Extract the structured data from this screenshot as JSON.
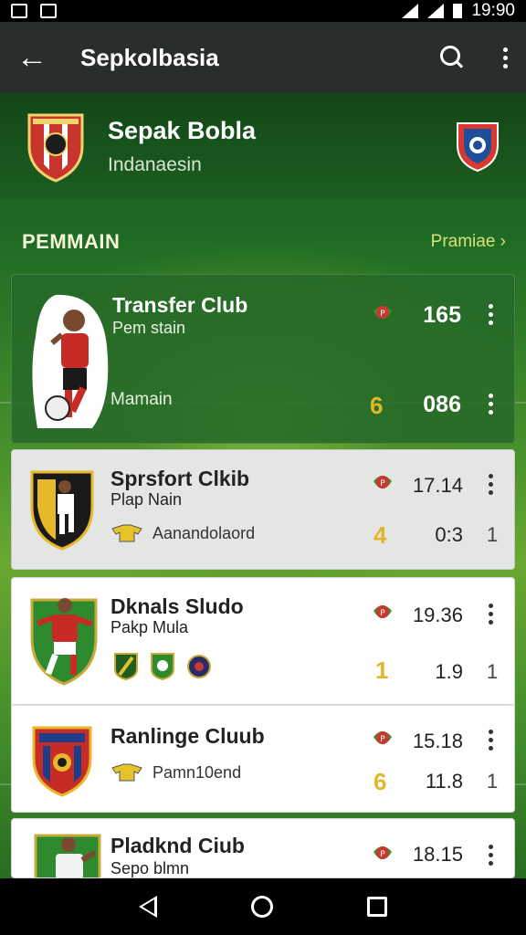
{
  "status_bar": {
    "time": "19:90"
  },
  "app_bar": {
    "title": "Sepkolbasia"
  },
  "header": {
    "title": "Sepak Bobla",
    "subtitle": "Indanaesin"
  },
  "section": {
    "label": "PEMMAIN",
    "link": "Pramiae ›"
  },
  "featured": {
    "name": "Transfer Club",
    "sub": "Pem stain",
    "caption": "Mamain",
    "value_top": "165",
    "rank": "6",
    "value_bottom": "086"
  },
  "rows": [
    {
      "name": "Sprsfort Clkib",
      "sub": "Plap Nain",
      "caption": "Aanandolaord",
      "value_top": "17.14",
      "rank": "4",
      "value_bottom": "0:3",
      "small": "1"
    },
    {
      "name": "Dknals Sludo",
      "sub": "Pakp Mula",
      "value_top": "19.36",
      "rank": "1",
      "value_bottom": "1.9",
      "small": "1"
    },
    {
      "name": "Ranlinge Cluub",
      "caption": "Pamn10end",
      "value_top": "15.18",
      "rank": "6",
      "value_bottom": "11.8",
      "small": "1"
    },
    {
      "name": "Pladknd Ciub",
      "sub": "Sepo blmn",
      "value_top": "18.15"
    }
  ],
  "colors": {
    "accent": "#e3b62a",
    "green_dark": "#1c5e20",
    "link": "#d9e07a",
    "badge_red": "#c43a2e"
  },
  "icons": [
    "back-arrow-icon",
    "search-icon",
    "more-vert-icon",
    "rank-badge-icon",
    "jersey-icon"
  ]
}
